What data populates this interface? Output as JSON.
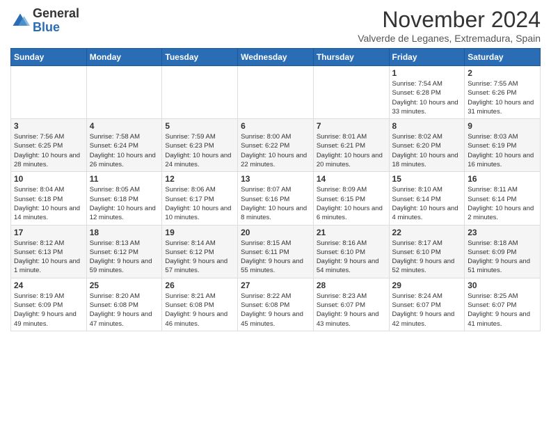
{
  "header": {
    "logo_general": "General",
    "logo_blue": "Blue",
    "month_title": "November 2024",
    "subtitle": "Valverde de Leganes, Extremadura, Spain"
  },
  "days_of_week": [
    "Sunday",
    "Monday",
    "Tuesday",
    "Wednesday",
    "Thursday",
    "Friday",
    "Saturday"
  ],
  "weeks": [
    [
      {
        "day": "",
        "info": ""
      },
      {
        "day": "",
        "info": ""
      },
      {
        "day": "",
        "info": ""
      },
      {
        "day": "",
        "info": ""
      },
      {
        "day": "",
        "info": ""
      },
      {
        "day": "1",
        "info": "Sunrise: 7:54 AM\nSunset: 6:28 PM\nDaylight: 10 hours and 33 minutes."
      },
      {
        "day": "2",
        "info": "Sunrise: 7:55 AM\nSunset: 6:26 PM\nDaylight: 10 hours and 31 minutes."
      }
    ],
    [
      {
        "day": "3",
        "info": "Sunrise: 7:56 AM\nSunset: 6:25 PM\nDaylight: 10 hours and 28 minutes."
      },
      {
        "day": "4",
        "info": "Sunrise: 7:58 AM\nSunset: 6:24 PM\nDaylight: 10 hours and 26 minutes."
      },
      {
        "day": "5",
        "info": "Sunrise: 7:59 AM\nSunset: 6:23 PM\nDaylight: 10 hours and 24 minutes."
      },
      {
        "day": "6",
        "info": "Sunrise: 8:00 AM\nSunset: 6:22 PM\nDaylight: 10 hours and 22 minutes."
      },
      {
        "day": "7",
        "info": "Sunrise: 8:01 AM\nSunset: 6:21 PM\nDaylight: 10 hours and 20 minutes."
      },
      {
        "day": "8",
        "info": "Sunrise: 8:02 AM\nSunset: 6:20 PM\nDaylight: 10 hours and 18 minutes."
      },
      {
        "day": "9",
        "info": "Sunrise: 8:03 AM\nSunset: 6:19 PM\nDaylight: 10 hours and 16 minutes."
      }
    ],
    [
      {
        "day": "10",
        "info": "Sunrise: 8:04 AM\nSunset: 6:18 PM\nDaylight: 10 hours and 14 minutes."
      },
      {
        "day": "11",
        "info": "Sunrise: 8:05 AM\nSunset: 6:18 PM\nDaylight: 10 hours and 12 minutes."
      },
      {
        "day": "12",
        "info": "Sunrise: 8:06 AM\nSunset: 6:17 PM\nDaylight: 10 hours and 10 minutes."
      },
      {
        "day": "13",
        "info": "Sunrise: 8:07 AM\nSunset: 6:16 PM\nDaylight: 10 hours and 8 minutes."
      },
      {
        "day": "14",
        "info": "Sunrise: 8:09 AM\nSunset: 6:15 PM\nDaylight: 10 hours and 6 minutes."
      },
      {
        "day": "15",
        "info": "Sunrise: 8:10 AM\nSunset: 6:14 PM\nDaylight: 10 hours and 4 minutes."
      },
      {
        "day": "16",
        "info": "Sunrise: 8:11 AM\nSunset: 6:14 PM\nDaylight: 10 hours and 2 minutes."
      }
    ],
    [
      {
        "day": "17",
        "info": "Sunrise: 8:12 AM\nSunset: 6:13 PM\nDaylight: 10 hours and 1 minute."
      },
      {
        "day": "18",
        "info": "Sunrise: 8:13 AM\nSunset: 6:12 PM\nDaylight: 9 hours and 59 minutes."
      },
      {
        "day": "19",
        "info": "Sunrise: 8:14 AM\nSunset: 6:12 PM\nDaylight: 9 hours and 57 minutes."
      },
      {
        "day": "20",
        "info": "Sunrise: 8:15 AM\nSunset: 6:11 PM\nDaylight: 9 hours and 55 minutes."
      },
      {
        "day": "21",
        "info": "Sunrise: 8:16 AM\nSunset: 6:10 PM\nDaylight: 9 hours and 54 minutes."
      },
      {
        "day": "22",
        "info": "Sunrise: 8:17 AM\nSunset: 6:10 PM\nDaylight: 9 hours and 52 minutes."
      },
      {
        "day": "23",
        "info": "Sunrise: 8:18 AM\nSunset: 6:09 PM\nDaylight: 9 hours and 51 minutes."
      }
    ],
    [
      {
        "day": "24",
        "info": "Sunrise: 8:19 AM\nSunset: 6:09 PM\nDaylight: 9 hours and 49 minutes."
      },
      {
        "day": "25",
        "info": "Sunrise: 8:20 AM\nSunset: 6:08 PM\nDaylight: 9 hours and 47 minutes."
      },
      {
        "day": "26",
        "info": "Sunrise: 8:21 AM\nSunset: 6:08 PM\nDaylight: 9 hours and 46 minutes."
      },
      {
        "day": "27",
        "info": "Sunrise: 8:22 AM\nSunset: 6:08 PM\nDaylight: 9 hours and 45 minutes."
      },
      {
        "day": "28",
        "info": "Sunrise: 8:23 AM\nSunset: 6:07 PM\nDaylight: 9 hours and 43 minutes."
      },
      {
        "day": "29",
        "info": "Sunrise: 8:24 AM\nSunset: 6:07 PM\nDaylight: 9 hours and 42 minutes."
      },
      {
        "day": "30",
        "info": "Sunrise: 8:25 AM\nSunset: 6:07 PM\nDaylight: 9 hours and 41 minutes."
      }
    ]
  ]
}
